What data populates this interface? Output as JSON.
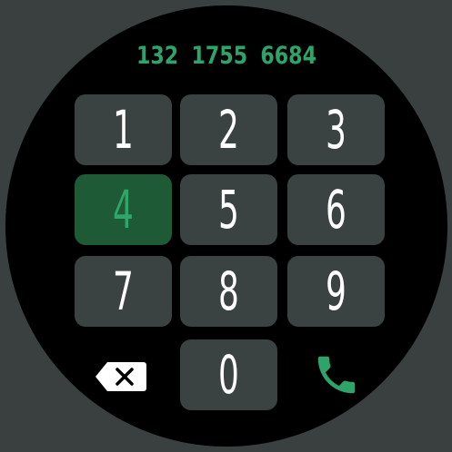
{
  "dial": {
    "number": "132 1755 6684"
  },
  "keypad": {
    "keys": [
      {
        "label": "1",
        "active": false
      },
      {
        "label": "2",
        "active": false
      },
      {
        "label": "3",
        "active": false
      },
      {
        "label": "4",
        "active": true
      },
      {
        "label": "5",
        "active": false
      },
      {
        "label": "6",
        "active": false
      },
      {
        "label": "7",
        "active": false
      },
      {
        "label": "8",
        "active": false
      },
      {
        "label": "9",
        "active": false
      },
      {
        "label": "0",
        "active": false
      }
    ]
  },
  "icons": {
    "delete": "backspace-icon",
    "call": "phone-icon"
  },
  "colors": {
    "accent": "#2ea36a",
    "active_key_bg": "#1f5a36",
    "key_bg": "#3b4242",
    "frame": "#3a3f3f"
  }
}
